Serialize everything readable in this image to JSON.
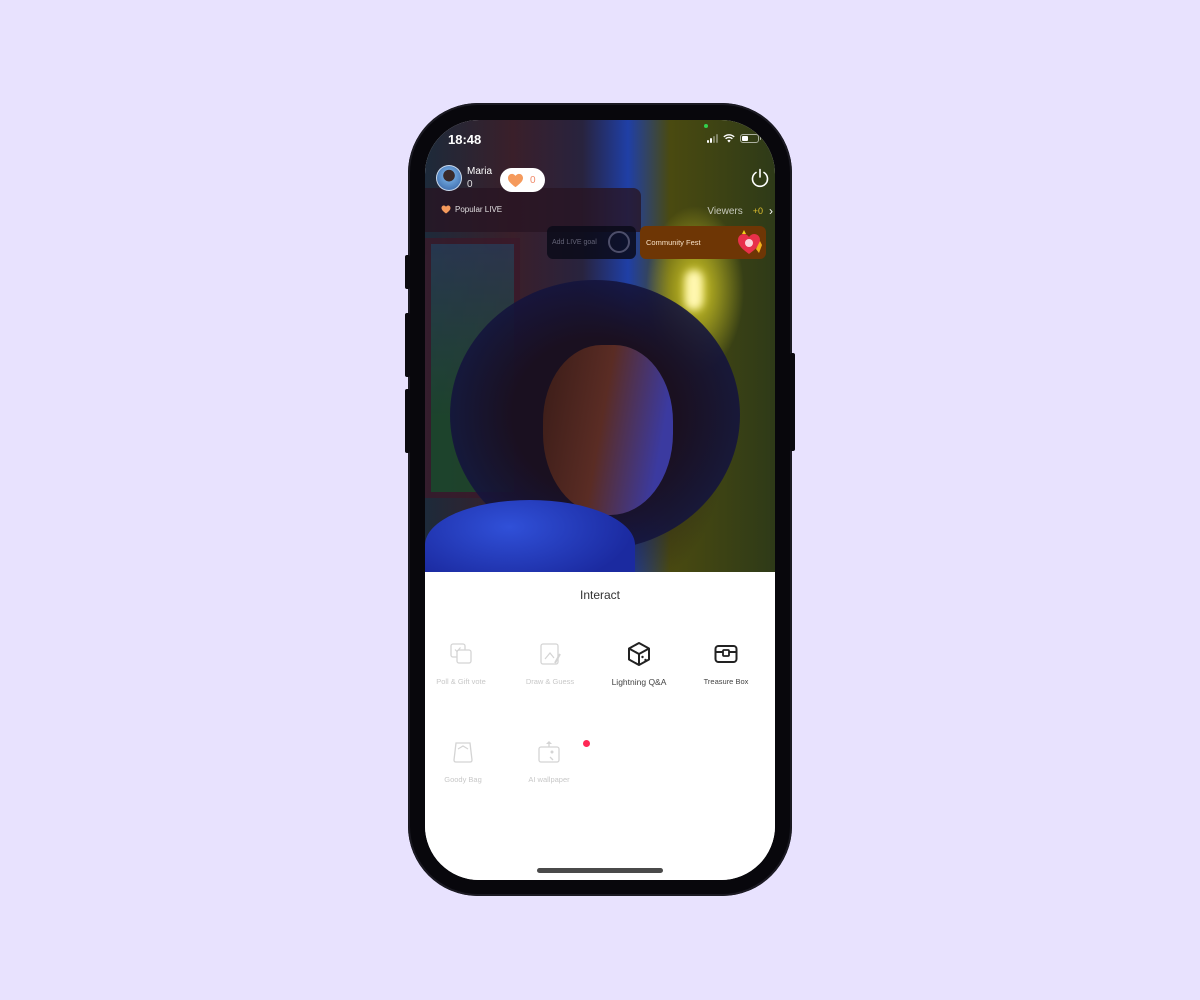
{
  "status_bar": {
    "time": "18:48",
    "battery_level": 0.4,
    "signal_bars": 4,
    "signal_active": 2
  },
  "host": {
    "name": "Maria",
    "count": "0"
  },
  "likes": {
    "count": "0",
    "color": "#f59a5c"
  },
  "popular": {
    "label": "Popular LIVE"
  },
  "viewers": {
    "label": "Viewers",
    "count": "+0"
  },
  "cards": {
    "goal": {
      "label": "Add LIVE goal"
    },
    "fest": {
      "label": "Community Fest",
      "bg_color": "#6e3605"
    }
  },
  "interact": {
    "title": "Interact",
    "items": [
      {
        "label": "Poll & Gift vote",
        "icon": "poll-icon",
        "enabled": false
      },
      {
        "label": "Draw & Guess",
        "icon": "draw-icon",
        "enabled": false
      },
      {
        "label": "Lightning Q&A",
        "icon": "dice-cube-icon",
        "enabled": true
      },
      {
        "label": "Treasure Box",
        "icon": "treasure-chest-icon",
        "enabled": true
      },
      {
        "label": "Goody Bag",
        "icon": "bag-icon",
        "enabled": false
      },
      {
        "label": "AI wallpaper",
        "icon": "wallpaper-icon",
        "enabled": false,
        "badge": true
      }
    ],
    "badge_color": "#ff2855"
  }
}
